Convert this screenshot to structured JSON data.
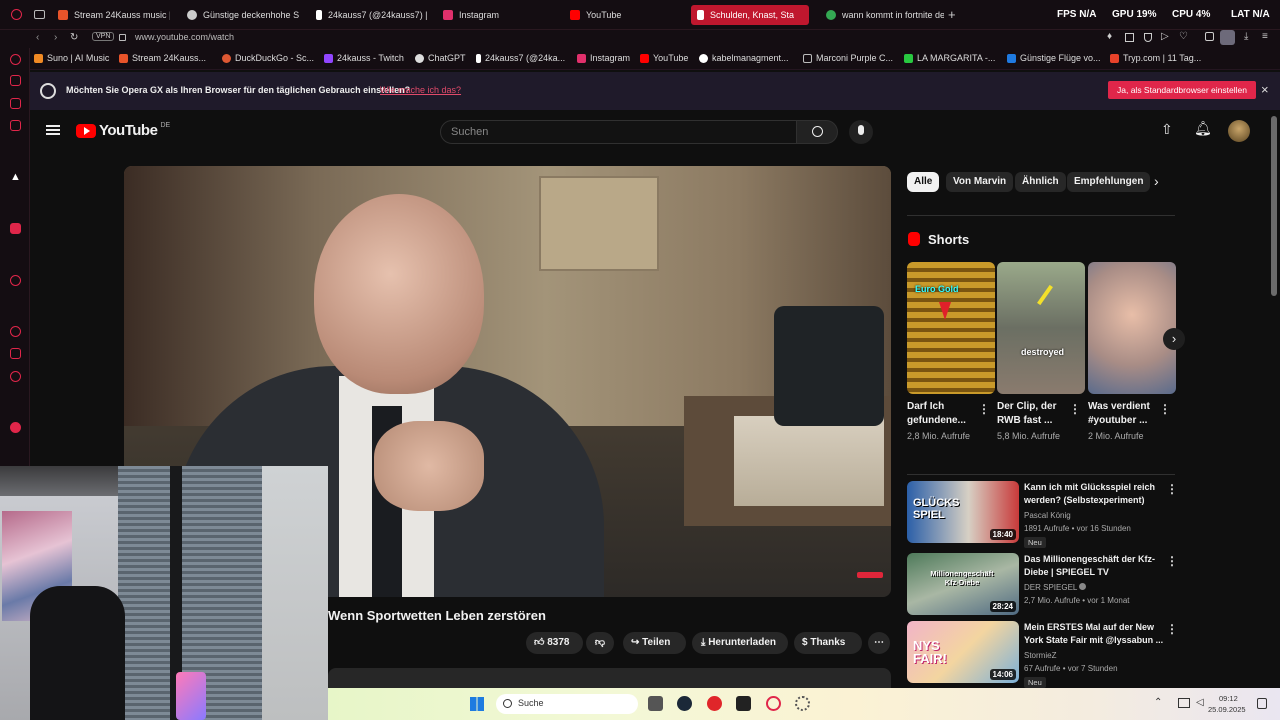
{
  "tabs": [
    {
      "label": "Stream 24Kauss music | L",
      "color": "#e8542a"
    },
    {
      "label": "Günstige deckenhohe Sc",
      "color": "#cccccc"
    },
    {
      "label": "24kauss7 (@24kauss7) |",
      "color": "#ffffff"
    },
    {
      "label": "Instagram",
      "color": "#e1306c"
    },
    {
      "label": "YouTube",
      "color": "#ff0000"
    },
    {
      "label": "Schulden, Knast, Sta",
      "color": "#ffffff"
    },
    {
      "label": "wann kommt in fortnite de",
      "color": "#34a853"
    }
  ],
  "stats": {
    "fps_label": "FPS",
    "fps_value": "N/A",
    "gpu_label": "GPU",
    "gpu_value": "19%",
    "cpu_label": "CPU",
    "cpu_value": "4%",
    "lat_label": "LAT",
    "lat_value": "N/A"
  },
  "address": {
    "vpn": "VPN",
    "url": "www.youtube.com/watch"
  },
  "bookmarks": [
    {
      "label": "Suno | AI Music",
      "color": "#f08a24"
    },
    {
      "label": "Stream 24Kauss...",
      "color": "#e8542a"
    },
    {
      "label": "DuckDuckGo - Sc...",
      "color": "#de5833"
    },
    {
      "label": "24kauss - Twitch",
      "color": "#9146ff"
    },
    {
      "label": "ChatGPT",
      "color": "#dddddd"
    },
    {
      "label": "24kauss7 (@24ka...",
      "color": "#ffffff"
    },
    {
      "label": "Instagram",
      "color": "#e1306c"
    },
    {
      "label": "YouTube",
      "color": "#ff0000"
    },
    {
      "label": "kabelmanagment...",
      "color": "#ffffff"
    },
    {
      "label": "Marconi Purple C...",
      "color": "#bbbbbb"
    },
    {
      "label": "LA MARGARITA -...",
      "color": "#28c840"
    },
    {
      "label": "Günstige Flüge vo...",
      "color": "#1f7ae0"
    },
    {
      "label": "Tryp.com | 11 Tag...",
      "color": "#e8422a"
    }
  ],
  "notice": {
    "text": "Möchten Sie Opera GX als Ihren Browser für den täglichen Gebrauch einstellen?",
    "link": "Wie mache ich das?",
    "button": "Ja, als Standardbrowser einstellen",
    "close": "×"
  },
  "youtube": {
    "logo": "YouTube",
    "region": "DE",
    "search_placeholder": "Suchen",
    "chips": [
      "Alle",
      "Von Marvin",
      "Ähnlich",
      "Empfehlungen"
    ],
    "video_title": "Wenn Sportwetten Leben zerstören",
    "actions": {
      "likes": "8378",
      "share": "Teilen",
      "download": "Herunterladen",
      "thanks": "Thanks"
    },
    "shorts_heading": "Shorts",
    "shorts": [
      {
        "overlay": "Euro Gold",
        "title": "Darf Ich gefundene...",
        "views": "2,8 Mio. Aufrufe"
      },
      {
        "overlay": "destroyed",
        "title": "Der Clip, der RWB fast ...",
        "views": "5,8 Mio. Aufrufe"
      },
      {
        "overlay": "",
        "title": "Was verdient #youtuber ...",
        "views": "2 Mio. Aufrufe"
      }
    ],
    "recommendations": [
      {
        "thumb_text": "GLÜCKS SPIEL",
        "duration": "18:40",
        "title": "Kann ich mit Glücksspiel reich werden? (Selbstexperiment)",
        "channel": "Pascal König",
        "meta": "1891 Aufrufe • vor 16 Stunden",
        "badge": "Neu"
      },
      {
        "thumb_text": "Millionengeschäft Kfz-Diebe",
        "duration": "28:24",
        "title": "Das Millionengeschäft der Kfz-Diebe | SPIEGEL TV",
        "channel": "DER SPIEGEL",
        "meta": "2,7 Mio. Aufrufe • vor 1 Monat",
        "badge": ""
      },
      {
        "thumb_text": "NYS FAIR!",
        "duration": "14:06",
        "title": "Mein ERSTES Mal auf der New York State Fair mit @lyssabun ...",
        "channel": "StormieZ",
        "meta": "67 Aufrufe • vor 7 Stunden",
        "badge": "Neu"
      }
    ]
  },
  "taskbar": {
    "search": "Suche",
    "time": "09:12",
    "date": "25.09.2025"
  }
}
